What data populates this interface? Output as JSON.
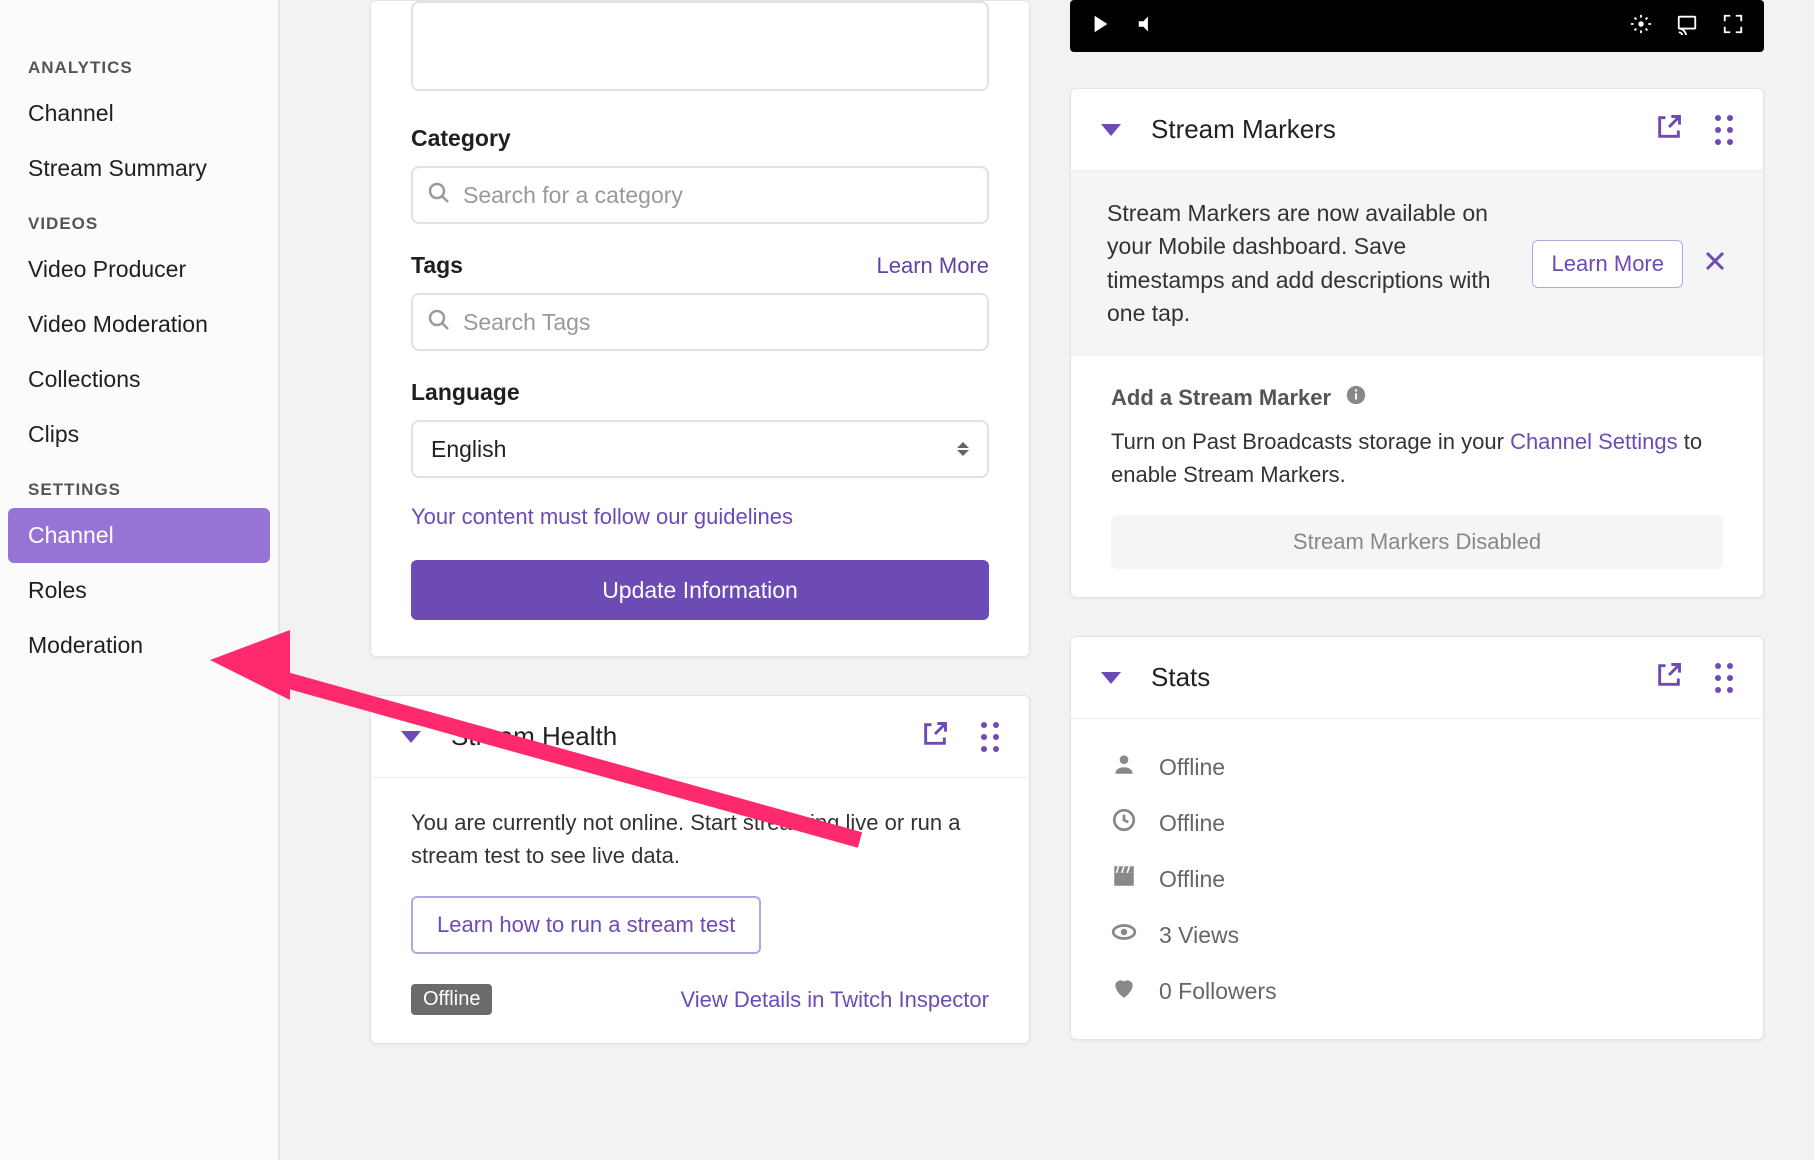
{
  "sidebar": {
    "groups": [
      {
        "heading": "ANALYTICS",
        "items": [
          {
            "label": "Channel",
            "active": false
          },
          {
            "label": "Stream Summary",
            "active": false
          }
        ]
      },
      {
        "heading": "VIDEOS",
        "items": [
          {
            "label": "Video Producer",
            "active": false
          },
          {
            "label": "Video Moderation",
            "active": false
          },
          {
            "label": "Collections",
            "active": false
          },
          {
            "label": "Clips",
            "active": false
          }
        ]
      },
      {
        "heading": "SETTINGS",
        "items": [
          {
            "label": "Channel",
            "active": true
          },
          {
            "label": "Roles",
            "active": false
          },
          {
            "label": "Moderation",
            "active": false
          }
        ]
      }
    ]
  },
  "stream_info": {
    "category_label": "Category",
    "category_placeholder": "Search for a category",
    "tags_label": "Tags",
    "tags_learn_more": "Learn More",
    "tags_placeholder": "Search Tags",
    "language_label": "Language",
    "language_value": "English",
    "guidelines_text": "Your content must follow our guidelines",
    "update_button": "Update Information"
  },
  "stream_health": {
    "title": "Stream Health",
    "text": "You are currently not online. Start streaming live or run a stream test to see live data.",
    "learn_button": "Learn how to run a stream test",
    "offline_badge": "Offline",
    "inspector_link": "View Details in Twitch Inspector"
  },
  "stream_markers": {
    "title": "Stream Markers",
    "banner_text": "Stream Markers are now available on your Mobile dashboard. Save timestamps and add descriptions with one tap.",
    "banner_button": "Learn More",
    "add_title": "Add a Stream Marker",
    "help_text_pre": "Turn on Past Broadcasts storage in your ",
    "help_link": "Channel Settings",
    "help_text_post": " to enable Stream Markers.",
    "disabled_button": "Stream Markers Disabled"
  },
  "stats": {
    "title": "Stats",
    "rows": [
      {
        "icon": "person",
        "text": "Offline"
      },
      {
        "icon": "clock",
        "text": "Offline"
      },
      {
        "icon": "clapper",
        "text": "Offline"
      },
      {
        "icon": "eye",
        "text": "3 Views"
      },
      {
        "icon": "heart",
        "text": "0 Followers"
      }
    ]
  }
}
